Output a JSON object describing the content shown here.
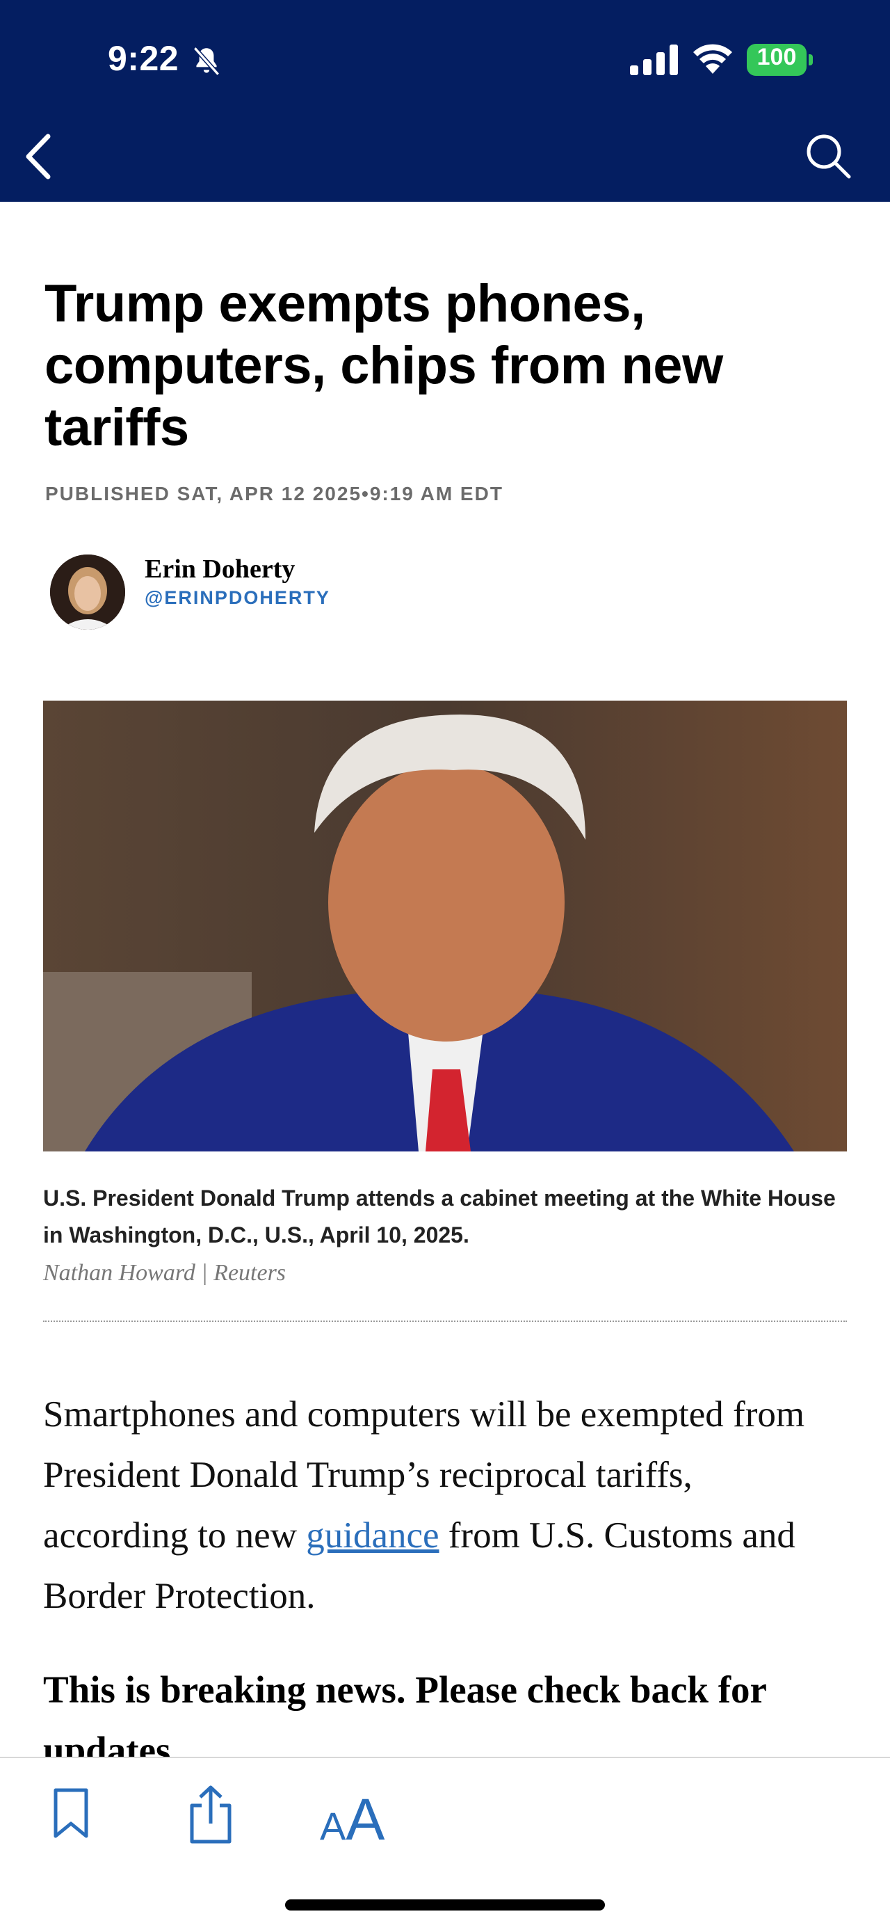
{
  "status_bar": {
    "time": "9:22",
    "battery": "100",
    "battery_color": "#34c759"
  },
  "nav": {
    "background": "#041e61",
    "back_icon": "chevron-left-icon",
    "search_icon": "search-icon"
  },
  "article": {
    "headline": "Trump exempts phones, computers, chips from new tariffs",
    "published": "PUBLISHED SAT, APR 12 2025•9:19 AM EDT",
    "author": {
      "name": "Erin Doherty",
      "handle": "@ERINPDOHERTY"
    },
    "image_caption": "U.S. President Donald Trump attends a cabinet meeting at the White House in Washington, D.C., U.S., April 10, 2025.",
    "image_credit": "Nathan Howard | Reuters",
    "paragraph_before_link": "Smartphones and computers will be exempted from President Donald Trump’s reciprocal tariffs, according to new ",
    "paragraph_link": "guidance",
    "paragraph_after_link": " from U.S. Customs and Border Protection.",
    "breaking_text": "This is breaking news. Please check back for updates.",
    "link_color": "#2a6ebb"
  },
  "toolbar": {
    "bookmark_icon": "bookmark-icon",
    "share_icon": "share-icon",
    "text_size_small": "A",
    "text_size_big": "A"
  }
}
